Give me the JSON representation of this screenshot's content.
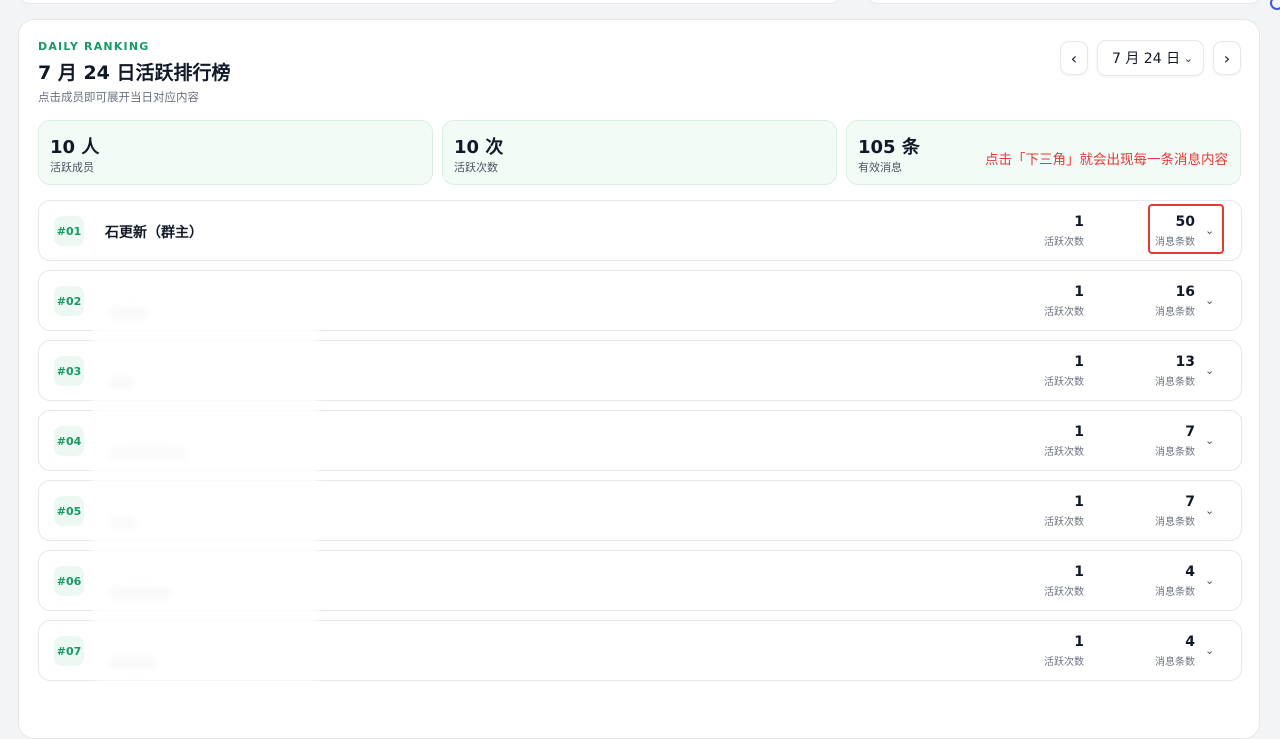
{
  "header": {
    "kicker": "DAILY RANKING",
    "title": "7 月 24 日活跃排行榜",
    "subtitle": "点击成员即可展开当日对应内容"
  },
  "date_nav": {
    "prev_label": "‹",
    "next_label": "›",
    "selected_date": "7 月 24 日"
  },
  "stats": [
    {
      "value": "10 人",
      "label": "活跃成员"
    },
    {
      "value": "10 次",
      "label": "活跃次数"
    },
    {
      "value": "105 条",
      "label": "有效消息"
    }
  ],
  "annotation": "点击「下三角」就会出现每一条消息内容",
  "columns": {
    "active_label": "活跃次数",
    "messages_label": "消息条数"
  },
  "rows": [
    {
      "rank": "#01",
      "name": "石更新（群主）",
      "active": "1",
      "messages": "50"
    },
    {
      "rank": "#02",
      "name": "",
      "active": "1",
      "messages": "16"
    },
    {
      "rank": "#03",
      "name": "",
      "active": "1",
      "messages": "13"
    },
    {
      "rank": "#04",
      "name": "",
      "active": "1",
      "messages": "7"
    },
    {
      "rank": "#05",
      "name": "",
      "active": "1",
      "messages": "7"
    },
    {
      "rank": "#06",
      "name": "",
      "active": "1",
      "messages": "4"
    },
    {
      "rank": "#07",
      "name": "",
      "active": "1",
      "messages": "4"
    }
  ],
  "colors": {
    "accent": "#179a63",
    "annotation": "#e53935"
  }
}
